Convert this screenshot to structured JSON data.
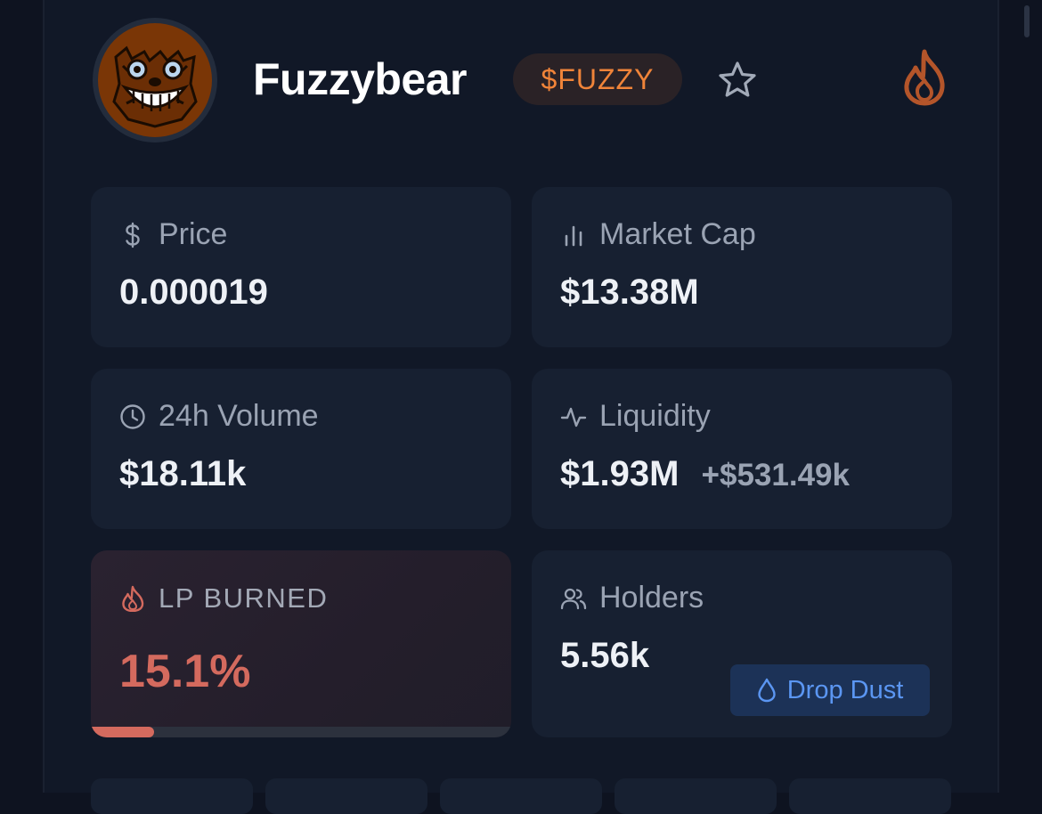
{
  "token": {
    "name": "Fuzzybear",
    "ticker": "$FUZZY",
    "avatar": "bear-face-avatar"
  },
  "icons": {
    "favorite": "star-icon",
    "trending": "fire-icon"
  },
  "colors": {
    "accent_orange": "#f08439",
    "burn_red": "#d46a5e",
    "blue_button": "#5b96f2",
    "card_bg": "#172031"
  },
  "stats": {
    "price": {
      "label": "Price",
      "icon": "dollar-icon",
      "value": "0.000019"
    },
    "market_cap": {
      "label": "Market Cap",
      "icon": "bar-chart-icon",
      "value": "$13.38M"
    },
    "volume": {
      "label": "24h Volume",
      "icon": "clock-icon",
      "value": "$18.11k"
    },
    "liquidity": {
      "label": "Liquidity",
      "icon": "activity-icon",
      "value": "$1.93M",
      "change": "+$531.49k"
    },
    "lp_burned": {
      "label": "LP BURNED",
      "icon": "fire-icon",
      "value": "15.1%",
      "progress_fraction": 0.151
    },
    "holders": {
      "label": "Holders",
      "icon": "users-icon",
      "value": "5.56k"
    }
  },
  "actions": {
    "drop_dust": {
      "label": "Drop Dust",
      "icon": "droplet-icon"
    }
  }
}
